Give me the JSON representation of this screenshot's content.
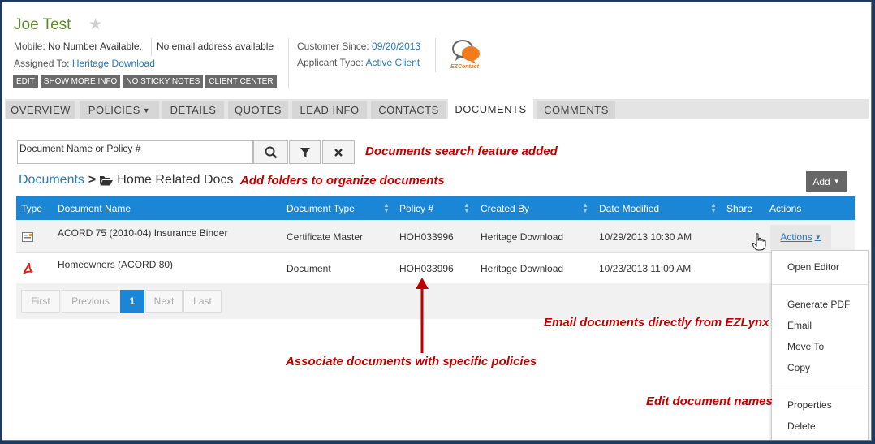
{
  "customer": {
    "name": "Joe Test",
    "mobile_label": "Mobile:",
    "mobile_value": "No Number Available.",
    "email": "No email address available",
    "assigned_label": "Assigned To:",
    "assigned_value": "Heritage Download",
    "since_label": "Customer Since:",
    "since_value": "09/20/2013",
    "applicant_label": "Applicant Type:",
    "applicant_value": "Active Client",
    "logo_text": "EZContact"
  },
  "quick_actions": [
    "EDIT",
    "SHOW MORE INFO",
    "NO STICKY NOTES",
    "CLIENT CENTER"
  ],
  "tabs": [
    {
      "label": "OVERVIEW"
    },
    {
      "label": "POLICIES"
    },
    {
      "label": "DETAILS"
    },
    {
      "label": "QUOTES"
    },
    {
      "label": "LEAD INFO"
    },
    {
      "label": "CONTACTS"
    },
    {
      "label": "DOCUMENTS",
      "active": true
    },
    {
      "label": "COMMENTS"
    }
  ],
  "search": {
    "value": "Document Name or Policy #"
  },
  "breadcrumb": {
    "root": "Documents",
    "separator": ">",
    "folder": "Home Related Docs"
  },
  "add_button": "Add",
  "table": {
    "columns": [
      "Type",
      "Document Name",
      "Document Type",
      "Policy #",
      "Created By",
      "Date Modified",
      "Share",
      "Actions"
    ],
    "rows": [
      {
        "name": "ACORD 75 (2010-04) Insurance Binder",
        "doc_type": "Certificate Master",
        "policy": "HOH033996",
        "created_by": "Heritage Download",
        "modified": "10/29/2013 10:30 AM",
        "actions": "Actions"
      },
      {
        "name": "Homeowners (ACORD 80)",
        "doc_type": "Document",
        "policy": "HOH033996",
        "created_by": "Heritage Download",
        "modified": "10/23/2013 11:09 AM"
      }
    ]
  },
  "pager": {
    "first": "First",
    "previous": "Previous",
    "page": "1",
    "next": "Next",
    "last": "Last"
  },
  "actions_menu": {
    "items": [
      "Open Editor",
      "Generate PDF",
      "Email",
      "Move To",
      "Copy",
      "Properties",
      "Delete"
    ]
  },
  "annotations": {
    "search": "Documents search feature added",
    "folders": "Add folders to organize documents",
    "email": "Email documents directly from EZLynx",
    "policies": "Associate documents with specific policies",
    "rename": "Edit document names",
    "color": "#c00000"
  },
  "colors": {
    "accent": "#1b86d6",
    "name": "#5b8a2b",
    "link": "#2a7ab8"
  }
}
